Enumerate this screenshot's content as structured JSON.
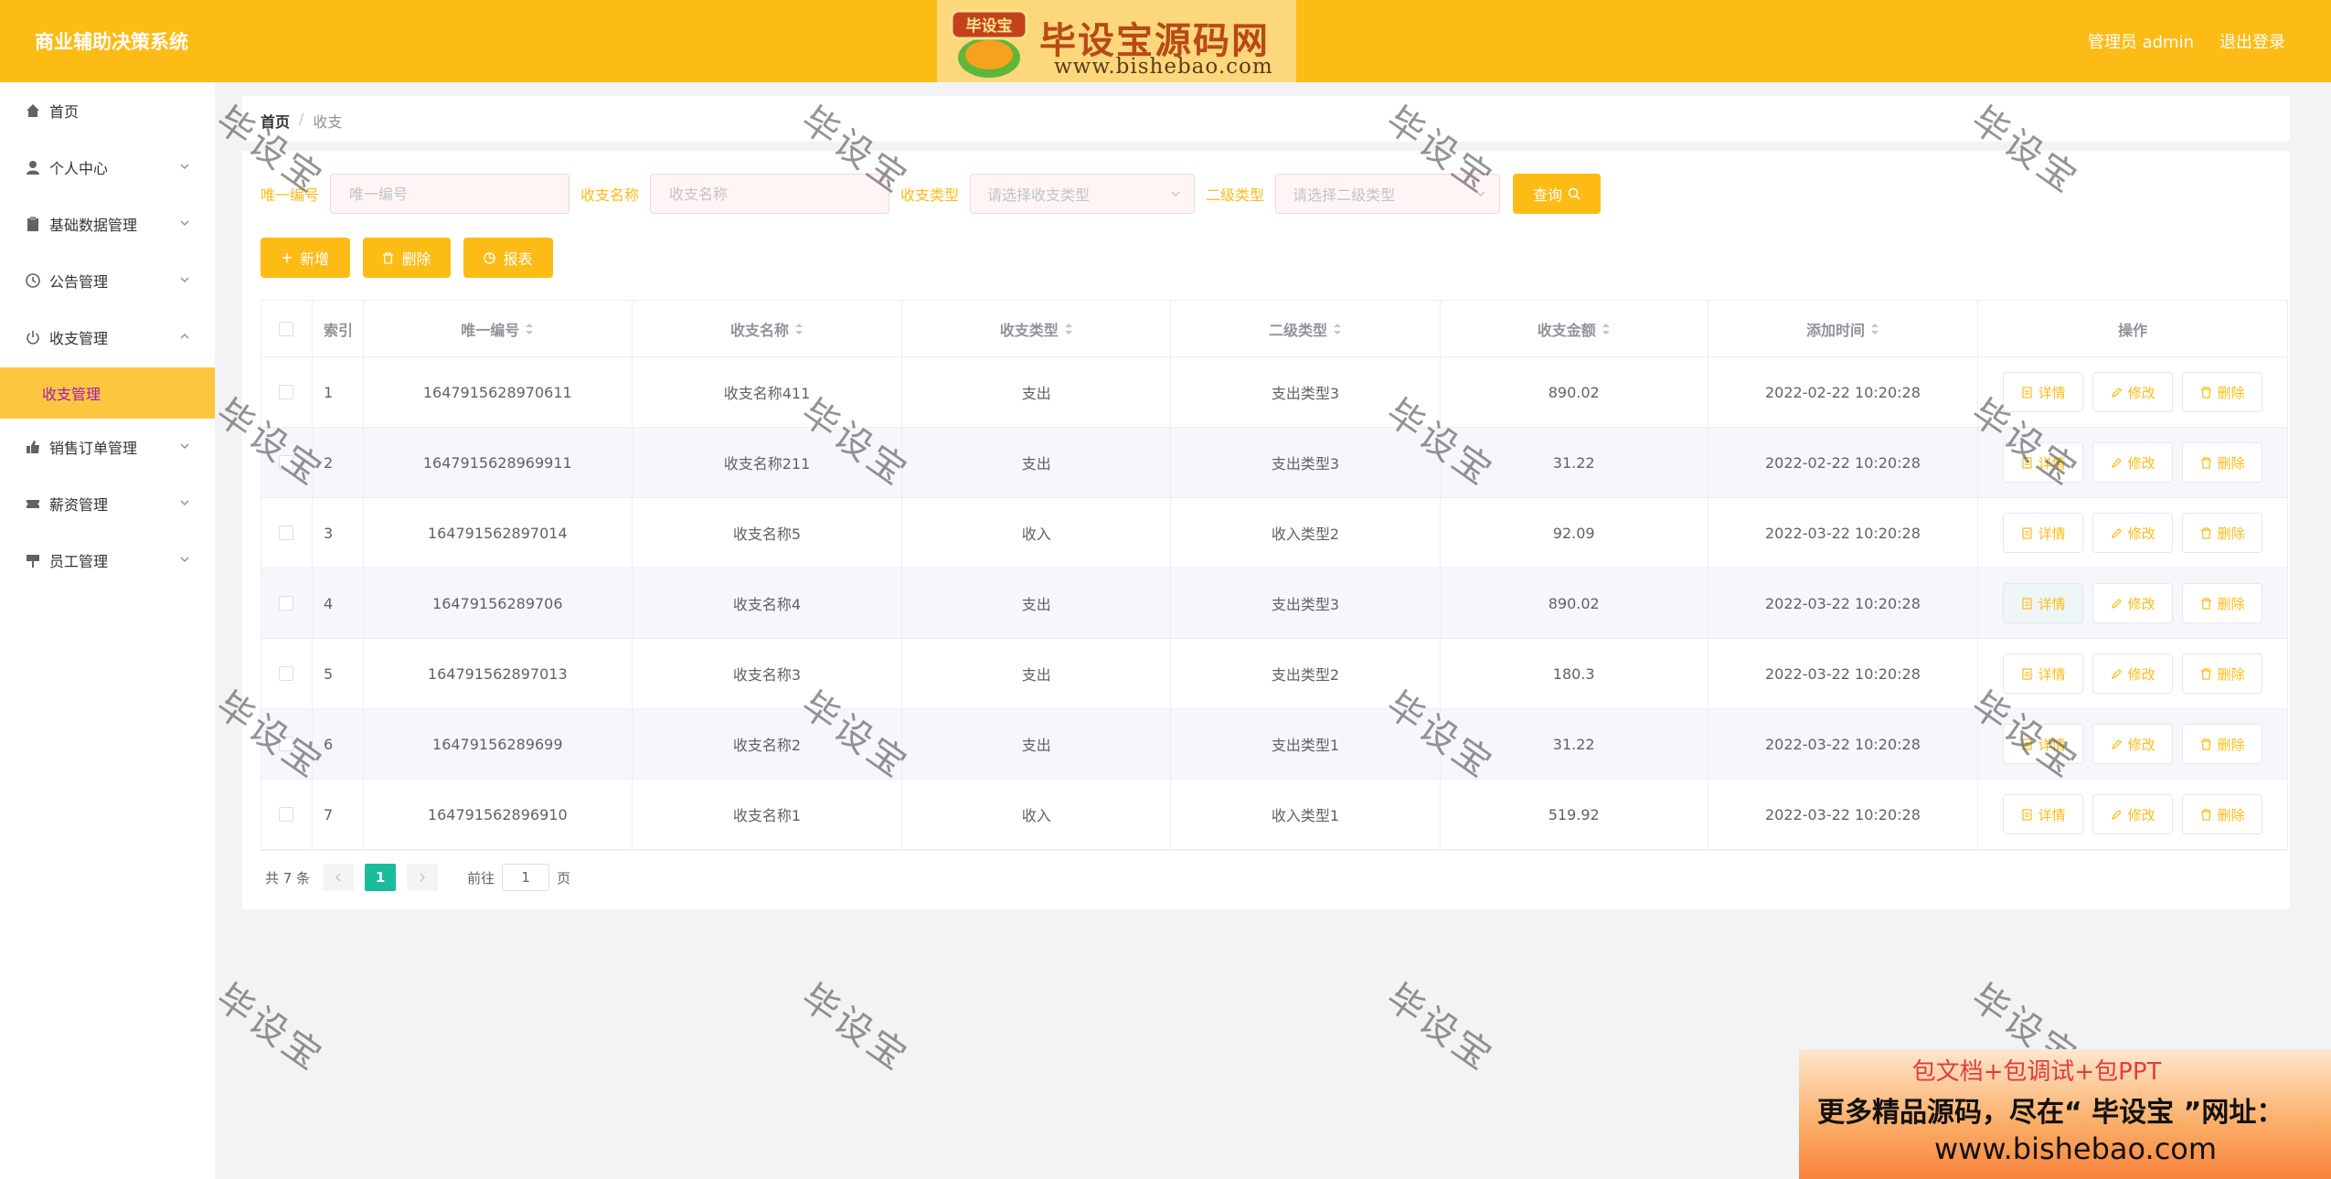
{
  "header": {
    "app_title": "商业辅助决策系统",
    "user_label": "管理员 admin",
    "logout_label": "退出登录"
  },
  "logo": {
    "badge_text": "毕设宝",
    "title": "毕设宝源码网",
    "url": "www.bishebao.com"
  },
  "sidebar": {
    "items": [
      {
        "label": "首页",
        "icon": "home-icon"
      },
      {
        "label": "个人中心",
        "icon": "user-icon"
      },
      {
        "label": "基础数据管理",
        "icon": "clipboard-icon"
      },
      {
        "label": "公告管理",
        "icon": "clock-icon"
      },
      {
        "label": "收支管理",
        "icon": "power-icon"
      },
      {
        "label": "销售订单管理",
        "icon": "thumb-icon"
      },
      {
        "label": "薪资管理",
        "icon": "ticket-icon"
      },
      {
        "label": "员工管理",
        "icon": "sign-icon"
      }
    ],
    "active_sub": "收支管理"
  },
  "breadcrumb": {
    "home": "首页",
    "separator": "/",
    "current": "收支"
  },
  "search": {
    "no_label": "唯一编号",
    "no_placeholder": "唯一编号",
    "name_label": "收支名称",
    "name_placeholder": "收支名称",
    "type_label": "收支类型",
    "type_placeholder": "请选择收支类型",
    "sub_label": "二级类型",
    "sub_placeholder": "请选择二级类型",
    "query_label": "查询"
  },
  "actions": {
    "add": "新增",
    "delete": "删除",
    "report": "报表"
  },
  "table": {
    "headers": {
      "index": "索引",
      "no": "唯一编号",
      "name": "收支名称",
      "type": "收支类型",
      "sub": "二级类型",
      "amount": "收支金额",
      "time": "添加时间",
      "ops": "操作"
    },
    "op_labels": {
      "detail": "详情",
      "edit": "修改",
      "delete": "删除"
    },
    "rows": [
      {
        "index": "1",
        "no": "1647915628970611",
        "name": "收支名称411",
        "type": "支出",
        "sub": "支出类型3",
        "amount": "890.02",
        "time": "2022-02-22 10:20:28"
      },
      {
        "index": "2",
        "no": "1647915628969911",
        "name": "收支名称211",
        "type": "支出",
        "sub": "支出类型3",
        "amount": "31.22",
        "time": "2022-02-22 10:20:28"
      },
      {
        "index": "3",
        "no": "164791562897014",
        "name": "收支名称5",
        "type": "收入",
        "sub": "收入类型2",
        "amount": "92.09",
        "time": "2022-03-22 10:20:28"
      },
      {
        "index": "4",
        "no": "16479156289706",
        "name": "收支名称4",
        "type": "支出",
        "sub": "支出类型3",
        "amount": "890.02",
        "time": "2022-03-22 10:20:28"
      },
      {
        "index": "5",
        "no": "164791562897013",
        "name": "收支名称3",
        "type": "支出",
        "sub": "支出类型2",
        "amount": "180.3",
        "time": "2022-03-22 10:20:28"
      },
      {
        "index": "6",
        "no": "16479156289699",
        "name": "收支名称2",
        "type": "支出",
        "sub": "支出类型1",
        "amount": "31.22",
        "time": "2022-03-22 10:20:28"
      },
      {
        "index": "7",
        "no": "164791562896910",
        "name": "收支名称1",
        "type": "收入",
        "sub": "收入类型1",
        "amount": "519.92",
        "time": "2022-03-22 10:20:28"
      }
    ]
  },
  "pagination": {
    "total": "共 7 条",
    "current_page": "1",
    "goto_label": "前往",
    "goto_value": "1",
    "page_suffix": "页"
  },
  "watermark": "毕设宝",
  "ad": {
    "line1": "包文档+包调试+包PPT",
    "line2": "更多精品源码，尽在“ 毕设宝 ”网址：",
    "line3": "www.bishebao.com"
  },
  "colors": {
    "primary": "#fdbb16",
    "active_sub_text": "#a61bb3",
    "pager_active": "#1abc9c"
  }
}
